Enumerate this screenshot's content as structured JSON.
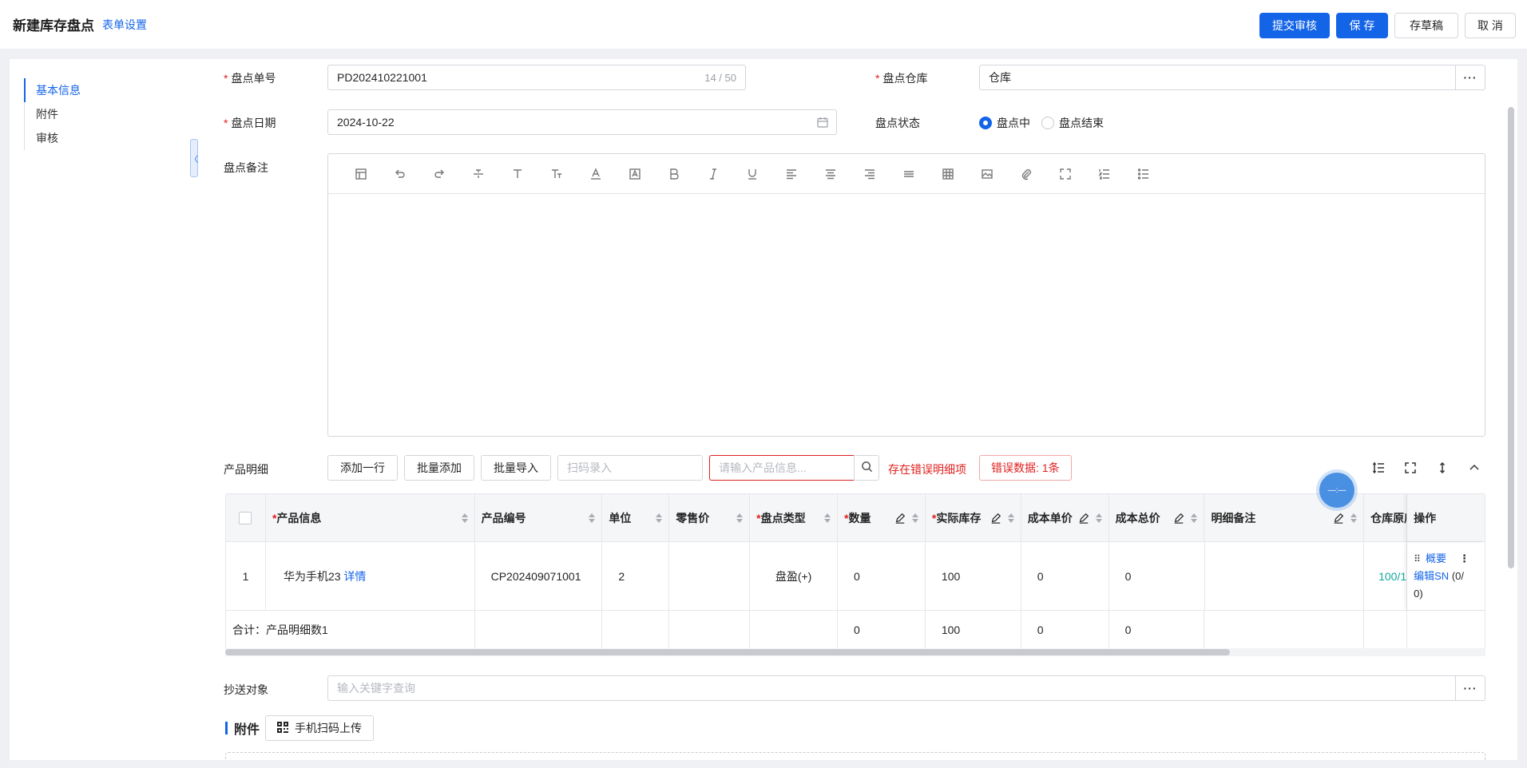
{
  "header": {
    "title": "新建库存盘点",
    "form_settings": "表单设置",
    "submit_review": "提交审核",
    "save": "保 存",
    "save_draft": "存草稿",
    "cancel": "取 消"
  },
  "sidebar": {
    "items": [
      {
        "label": "基本信息",
        "active": true
      },
      {
        "label": "附件",
        "active": false
      },
      {
        "label": "审核",
        "active": false
      }
    ]
  },
  "form": {
    "order_no": {
      "label": "盘点单号",
      "value": "PD202410221001",
      "counter": "14 / 50"
    },
    "warehouse": {
      "label": "盘点仓库",
      "value": "仓库",
      "more": "···"
    },
    "date": {
      "label": "盘点日期",
      "value": "2024-10-22"
    },
    "status": {
      "label": "盘点状态",
      "options": [
        "盘点中",
        "盘点结束"
      ],
      "selected": "盘点中"
    },
    "remark": {
      "label": "盘点备注"
    }
  },
  "editor_toolbar": [
    "table-layout-icon",
    "undo-icon",
    "redo-icon",
    "strikethrough-icon",
    "text-icon",
    "font-size-icon",
    "font-color-icon",
    "background-color-icon",
    "bold-icon",
    "italic-icon",
    "underline-icon",
    "align-left-icon",
    "align-center-icon",
    "align-right-icon",
    "justify-icon",
    "insert-table-icon",
    "insert-image-icon",
    "attachment-icon",
    "fullscreen-icon",
    "ordered-list-icon",
    "unordered-list-icon"
  ],
  "products": {
    "label": "产品明细",
    "add_row": "添加一行",
    "batch_add": "批量添加",
    "batch_import": "批量导入",
    "scan_placeholder": "扫码录入",
    "search_placeholder": "请输入产品信息...",
    "error_detail": "存在错误明细项",
    "error_count": "错误数据: 1条"
  },
  "table": {
    "headers": {
      "product_info": "产品信息",
      "product_code": "产品编号",
      "unit": "单位",
      "retail_price": "零售价",
      "count_type": "盘点类型",
      "quantity": "数量",
      "actual_stock": "实际库存",
      "cost_unit": "成本单价",
      "cost_total": "成本总价",
      "detail_remark": "明细备注",
      "warehouse_orig": "仓库原库",
      "actions": "操作"
    },
    "row": {
      "index": "1",
      "product_name": "华为手机23",
      "detail_link": "详情",
      "product_code": "CP202409071001",
      "unit": "2",
      "retail_price": "",
      "count_type": "盘盈(+)",
      "quantity": "0",
      "actual_stock": "100",
      "cost_unit": "0",
      "cost_total": "0",
      "detail_remark": "",
      "warehouse_orig": "100/1",
      "action_summary": "概要",
      "action_edit_sn": "编辑SN",
      "action_sn_count": "(0/",
      "action_sn_count2": "0)"
    },
    "total": {
      "label": "合计：产品明细数1",
      "quantity": "0",
      "actual_stock": "100",
      "cost_unit": "0",
      "cost_total": "0"
    }
  },
  "cc": {
    "label": "抄送对象",
    "placeholder": "输入关键字查询",
    "more": "···"
  },
  "attachments": {
    "title": "附件",
    "qr_upload": "手机扫码上传"
  },
  "float_ball": "—:—"
}
